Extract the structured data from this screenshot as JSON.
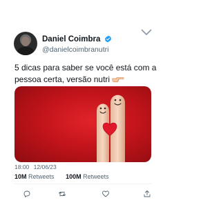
{
  "author": {
    "name": "Daniel Coimbra",
    "handle": "@danielcoimbranutri"
  },
  "tweet": {
    "text": "5 dicas para saber se você está com a pessoa certa, versão nutri"
  },
  "meta": {
    "time": "18:00",
    "date": "12/06/23"
  },
  "stats": {
    "retweets_count": "10M",
    "retweets_label": "Retweets",
    "quotes_count": "100M",
    "quotes_label": "Retweets"
  },
  "colors": {
    "verified_badge": "#1d9bf0",
    "media_red": "#c3141b",
    "muted_text": "#536471",
    "primary_text": "#0f1419"
  },
  "icons": {
    "menu": "chevron-down-icon",
    "verified": "verified-badge-icon",
    "emoji": "pointing-hand-emoji",
    "actions": [
      "reply-icon",
      "retweet-icon",
      "like-icon",
      "share-icon"
    ]
  }
}
